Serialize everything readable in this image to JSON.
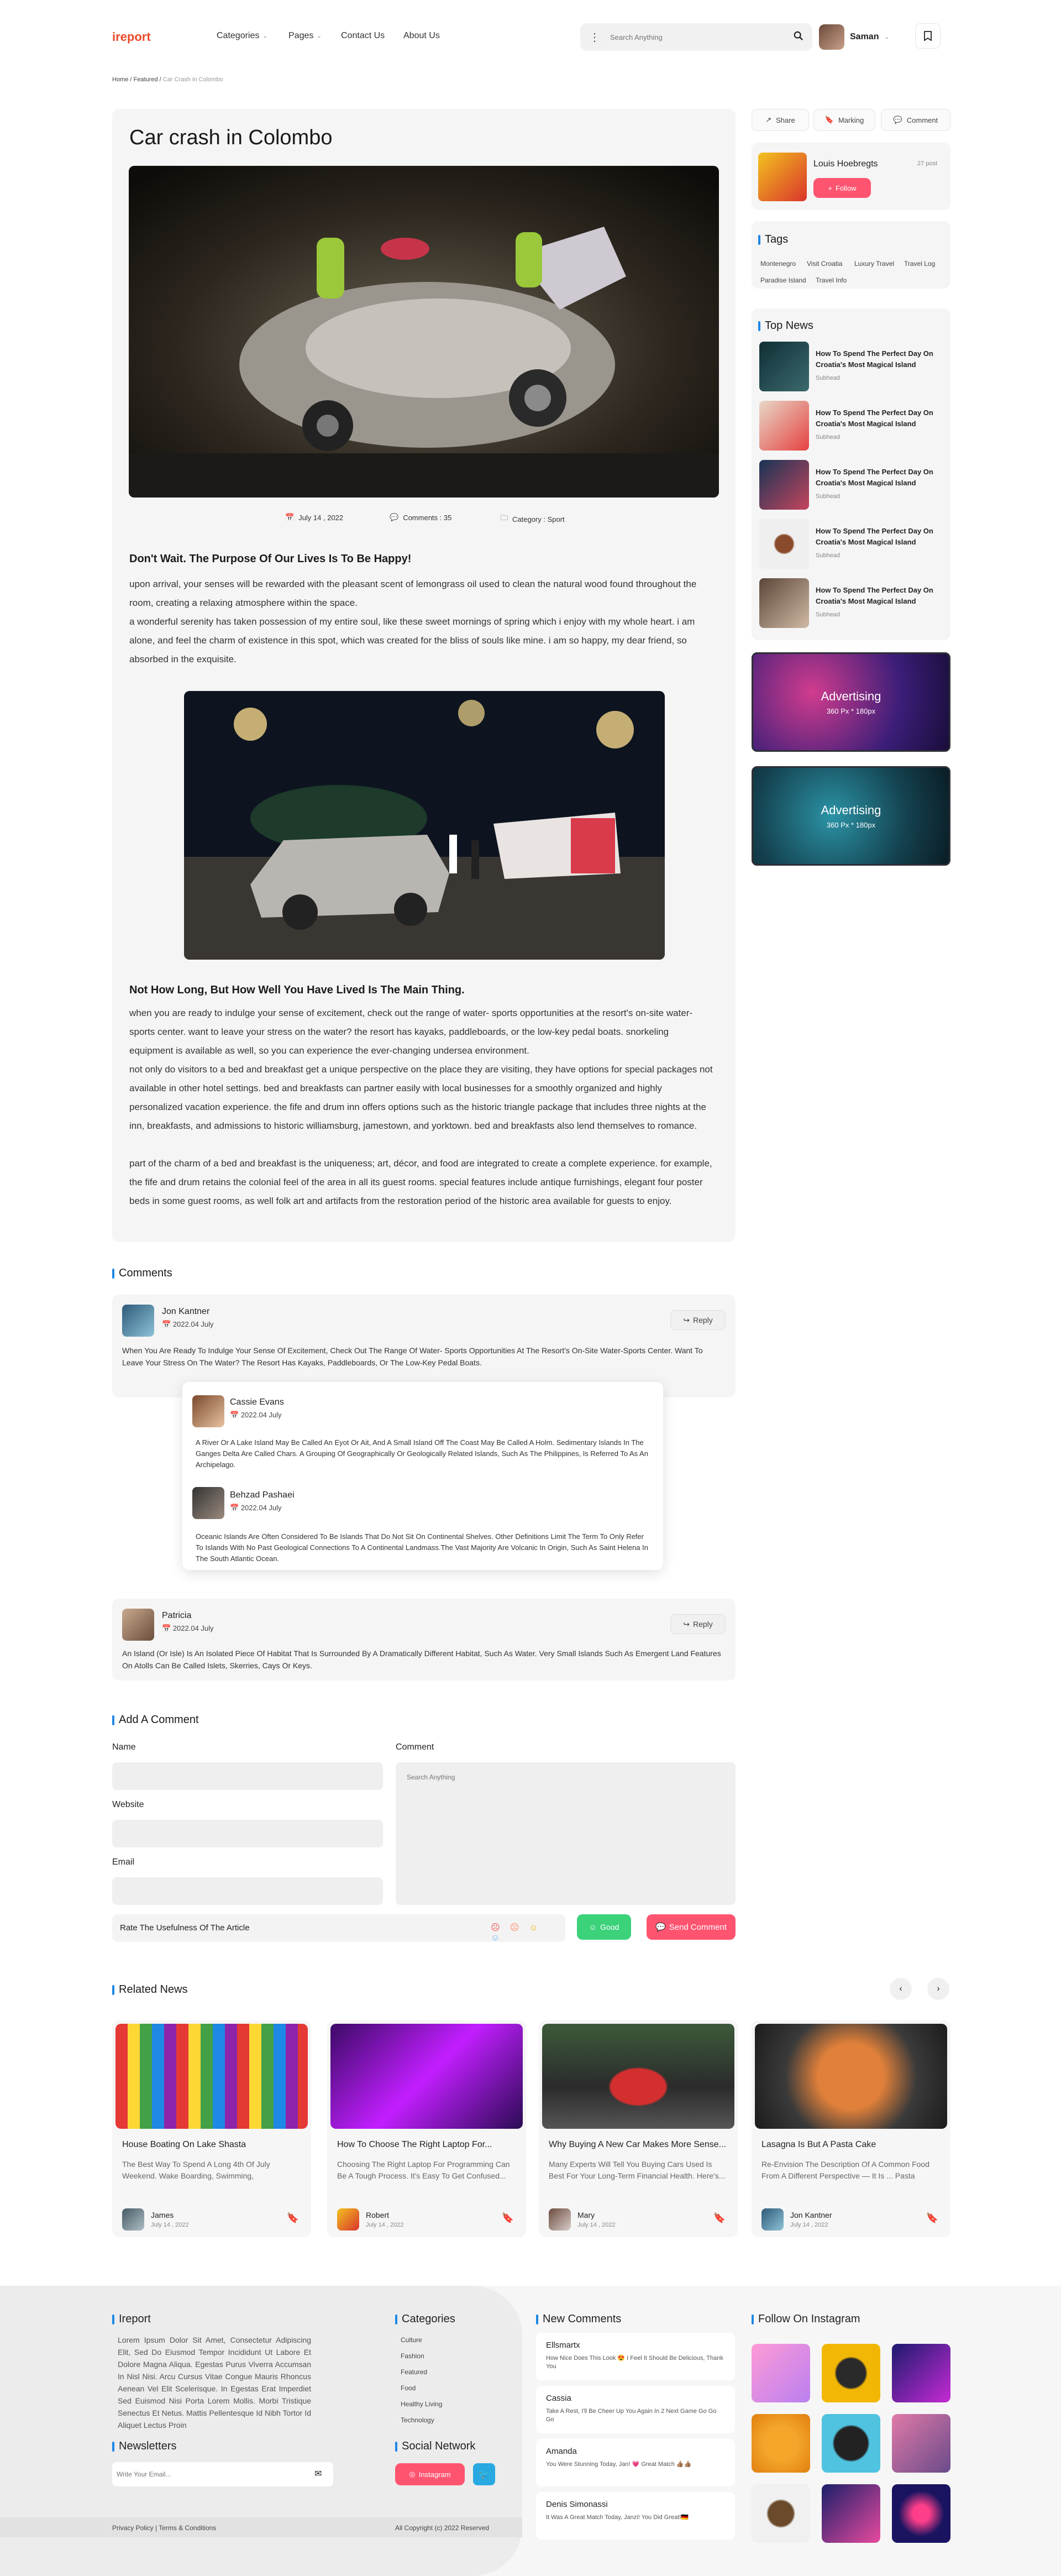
{
  "header": {
    "logo": "ireport",
    "nav": [
      "Categories",
      "Pages",
      "Contact Us",
      "About Us"
    ],
    "search_placeholder": "Search Anything",
    "user_name": "Saman"
  },
  "breadcrumb": {
    "home": "Home",
    "sep1": "/",
    "featured": "Featured",
    "sep2": "/",
    "current": "Car Crash in Colombo"
  },
  "article": {
    "title": "Car crash in Colombo",
    "date": "July 14 , 2022",
    "comments": "Comments : 35",
    "category": "Category : Sport",
    "heading1": "Don't Wait. The Purpose Of Our Lives Is To Be Happy!",
    "para1": "upon arrival, your senses will be rewarded with the pleasant scent of lemongrass oil used to clean the natural wood found throughout the room, creating a relaxing atmosphere within the space.",
    "para2": "a wonderful serenity has taken possession of my entire soul, like these sweet mornings of spring which i enjoy with my whole heart. i am alone, and feel the charm of existence in this spot, which was created for the bliss of souls like mine. i am so happy, my dear friend, so absorbed in the exquisite.",
    "heading2": "Not How Long, But How Well You Have Lived Is The Main Thing.",
    "para3": "when you are ready to indulge your sense of excitement, check out the range of water- sports opportunities at the resort's on-site water-sports center. want to leave your stress on the water? the resort has kayaks, paddleboards, or the low-key pedal boats. snorkeling equipment is available as well, so you can experience the ever-changing undersea environment.",
    "para4": "not only do visitors to a bed and breakfast get a unique perspective on the place they are visiting, they have options for special packages not available in other hotel settings. bed and breakfasts can partner easily with local businesses for a smoothly organized and highly personalized vacation experience. the fife and drum inn offers options such as the historic triangle package that includes three nights at the inn, breakfasts, and admissions to historic williamsburg, jamestown, and yorktown. bed and breakfasts also lend themselves to romance.",
    "para5": "part of the charm of a bed and breakfast is the uniqueness; art, décor, and food are integrated to create a complete experience. for example, the fife and drum retains the colonial feel of the area in all its guest rooms. special features include antique furnishings, elegant four poster beds in some guest rooms, as well folk art and artifacts from the restoration period of the historic area available for guests to enjoy."
  },
  "sidebar": {
    "share": "Share",
    "marking": "Marking",
    "comment": "Comment",
    "author": "Louis Hoebregts",
    "author_posts": "27 post",
    "follow": "Follow",
    "tags_title": "Tags",
    "tags": [
      "Montenegro",
      "Visit Croatia",
      "Luxury Travel",
      "Travel Log",
      "Paradise Island",
      "Travel Info"
    ],
    "top_news_title": "Top News",
    "top_news": [
      {
        "title": "How To Spend The Perfect Day On Croatia's Most Magical Island",
        "sub": "Subhead"
      },
      {
        "title": "How To Spend The Perfect Day On Croatia's Most Magical Island",
        "sub": "Subhead"
      },
      {
        "title": "How To Spend The Perfect Day On Croatia's Most Magical Island",
        "sub": "Subhead"
      },
      {
        "title": "How To Spend The Perfect Day On Croatia's Most Magical Island",
        "sub": "Subhead"
      },
      {
        "title": "How To Spend The Perfect Day On Croatia's Most Magical Island",
        "sub": "Subhead"
      }
    ],
    "ad_title": "Advertising",
    "ad_size": "360 Px * 180px"
  },
  "comments": {
    "title": "Comments",
    "reply": "Reply",
    "items": [
      {
        "name": "Jon Kantner",
        "date": "2022.04 July",
        "text": "When You Are Ready To Indulge Your Sense Of Excitement, Check Out The Range Of Water- Sports Opportunities At The Resort's On-Site Water-Sports Center. Want To Leave Your Stress On The Water? The Resort Has Kayaks, Paddleboards, Or The Low-Key Pedal Boats."
      },
      {
        "name": "Cassie Evans",
        "date": "2022.04 July",
        "text": "A River Or A Lake Island May Be Called An Eyot Or Ait, And A Small Island Off The Coast May Be Called A Holm. Sedimentary Islands In The Ganges Delta Are Called Chars. A Grouping Of Geographically Or Geologically Related Islands, Such As The Philippines, Is Referred To As An Archipelago."
      },
      {
        "name": "Behzad Pashaei",
        "date": "2022.04 July",
        "text": "Oceanic Islands Are Often Considered To Be Islands That Do Not Sit On Continental Shelves. Other Definitions Limit The Term To Only Refer To Islands With No Past Geological Connections To A Continental Landmass.The Vast Majority Are Volcanic In Origin, Such As Saint Helena In The South Atlantic Ocean."
      },
      {
        "name": "Patricia",
        "date": "2022.04 July",
        "text": "An Island (Or Isle) Is An Isolated Piece Of Habitat That Is Surrounded By A Dramatically Different Habitat, Such As Water. Very Small Islands Such As Emergent Land Features On Atolls Can Be Called Islets, Skerries, Cays Or Keys."
      }
    ]
  },
  "form": {
    "title": "Add A Comment",
    "name": "Name",
    "website": "Website",
    "email": "Email",
    "comment": "Comment",
    "comment_placeholder": "Search Anything",
    "rate": "Rate The Usefulness Of The Article",
    "good": "Good",
    "send": "Send Comment"
  },
  "related": {
    "title": "Related News",
    "items": [
      {
        "title": "House Boating On Lake Shasta",
        "desc": "The Best Way To Spend A Long 4th Of July Weekend. Wake Boarding, Swimming, Barbecues,...",
        "author": "James",
        "date": "July 14 , 2022"
      },
      {
        "title": "How To Choose The Right Laptop For...",
        "desc": "Choosing The Right Laptop For Programming Can Be A Tough Process. It's Easy To Get Confused...",
        "author": "Robert",
        "date": "July 14 , 2022"
      },
      {
        "title": "Why Buying A New Car Makes More Sense...",
        "desc": "Many Experts Will Tell You Buying Cars Used Is Best For Your Long-Term Financial Health. Here's...",
        "author": "Mary",
        "date": "July 14 , 2022"
      },
      {
        "title": "Lasagna Is But A Pasta Cake",
        "desc": "Re-Envision The Description Of A Common Food From A Different Perspective — It Is ... Pasta Cake...",
        "author": "Jon Kantner",
        "date": "July 14 , 2022"
      }
    ]
  },
  "footer": {
    "brand": "Ireport",
    "about": "Lorem Ipsum Dolor Sit Amet, Consectetur Adipiscing Elit, Sed Do Eiusmod Tempor Incididunt Ut Labore Et Dolore Magna Aliqua. Egestas Purus Viverra Accumsan In Nisl Nisi. Arcu Cursus Vitae Congue Mauris Rhoncus Aenean Vel Elit Scelerisque. In Egestas Erat Imperdiet Sed Euismod Nisi Porta Lorem Mollis. Morbi Tristique Senectus Et Netus. Mattis Pellentesque Id Nibh Tortor Id Aliquet Lectus Proin",
    "categories_title": "Categories",
    "categories": [
      "Culture",
      "Fashion",
      "Featured",
      "Food",
      "Healthy Living",
      "Technology"
    ],
    "newsletter_title": "Newsletters",
    "newsletter_placeholder": "Write Your Email...",
    "social_title": "Social Network",
    "instagram": "Instagram",
    "new_comments_title": "New Comments",
    "new_comments": [
      {
        "name": "Ellsmartx",
        "text": "How Nice Does This Look 😍 I Feel It Should Be Delicious, Thank You"
      },
      {
        "name": "Cassia",
        "text": "Take A Rest, I'll Be Cheer Up You Again In 2 Next Game Go Go Go"
      },
      {
        "name": "Amanda",
        "text": "You Were Stunning Today, Jan! 💗 Great Match 👍🏽👍🏽"
      },
      {
        "name": "Denis Simonassi",
        "text": "It Was A Great Match Today, Janzi! You Did Great!🇩🇪"
      }
    ],
    "instagram_title": "Follow On Instagram",
    "privacy": "Privacy Policy | Terms & Conditions",
    "copyright": "All Copyright (c) 2022 Reserved"
  },
  "colors": {
    "brand": "#ec4a2b",
    "accent_blue": "#1e88e5",
    "follow_red": "#ff5470",
    "good_green": "#3bd27a"
  }
}
